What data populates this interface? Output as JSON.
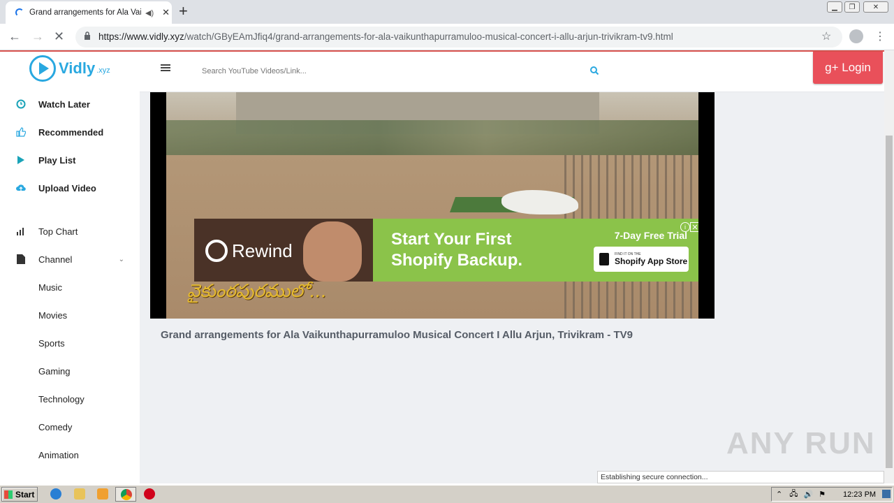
{
  "browser": {
    "tab_title": "Grand arrangements for Ala Vai",
    "audio_icon": "speaker-icon",
    "new_tab": "+",
    "url_host": "https://www.vidly.xyz",
    "url_path": "/watch/GByEAmJfiq4/grand-arrangements-for-ala-vaikunthapurramuloo-musical-concert-i-allu-arjun-trivikram-tv9.html"
  },
  "site": {
    "logo_name": "Vidly",
    "logo_suffix": ".xyz",
    "search_placeholder": "Search YouTube Videos/Link...",
    "login_label": "g+ Login"
  },
  "sidebar": {
    "main": [
      {
        "label": "Watch Later",
        "icon": "clock-icon"
      },
      {
        "label": "Recommended",
        "icon": "thumbs-up-icon"
      },
      {
        "label": "Play List",
        "icon": "play-icon"
      },
      {
        "label": "Upload Video",
        "icon": "cloud-upload-icon"
      }
    ],
    "top_chart": "Top Chart",
    "channel": "Channel",
    "channels": [
      "Music",
      "Movies",
      "Sports",
      "Gaming",
      "Technology",
      "Comedy",
      "Animation"
    ]
  },
  "video": {
    "caption": "వైకుంఠపురములో...",
    "title": "Grand arrangements for Ala Vaikunthapurramuloo Musical Concert I Allu Arjun, Trivikram - TV9"
  },
  "ad": {
    "brand": "Rewind",
    "headline_line1": "Start Your First",
    "headline_line2": "Shopify Backup.",
    "trial": "7-Day Free Trial",
    "store_small": "FIND IT ON THE",
    "store_big": "Shopify App Store"
  },
  "status_text": "Establishing secure connection...",
  "watermark": "ANY RUN",
  "taskbar": {
    "start_label": "Start",
    "clock": "12:23 PM"
  }
}
